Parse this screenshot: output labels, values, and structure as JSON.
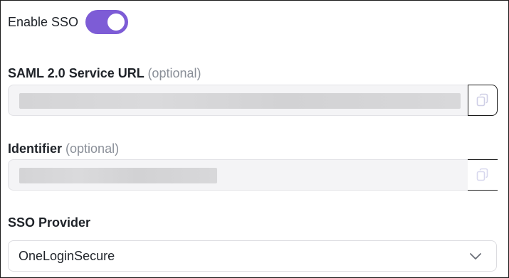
{
  "sso_toggle": {
    "label": "Enable SSO",
    "enabled": true,
    "color": "#7d5cd6"
  },
  "saml_url": {
    "label": "SAML 2.0 Service URL",
    "optional_hint": "(optional)",
    "copy_icon": "copy-icon"
  },
  "identifier": {
    "label": "Identifier",
    "optional_hint": "(optional)",
    "copy_icon": "copy-icon"
  },
  "sso_provider": {
    "label": "SSO Provider",
    "selected": "OneLoginSecure",
    "dropdown_icon": "chevron-down-icon"
  }
}
